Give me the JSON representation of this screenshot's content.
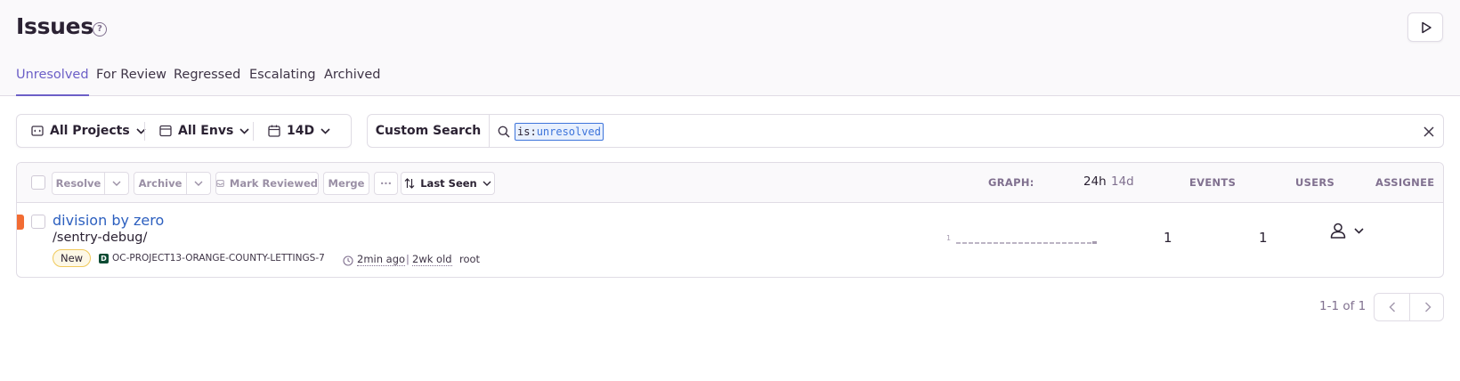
{
  "header": {
    "title": "Issues",
    "tabs": [
      {
        "label": "Unresolved",
        "active": true
      },
      {
        "label": "For Review",
        "active": false
      },
      {
        "label": "Regressed",
        "active": false
      },
      {
        "label": "Escalating",
        "active": false
      },
      {
        "label": "Archived",
        "active": false
      }
    ]
  },
  "filters": {
    "projects": "All Projects",
    "envs": "All Envs",
    "date": "14D"
  },
  "search": {
    "saved_search_label": "Custom Search",
    "token_key": "is:",
    "token_value": "unresolved"
  },
  "actions": {
    "resolve": "Resolve",
    "archive": "Archive",
    "mark_reviewed": "Mark Reviewed",
    "merge": "Merge",
    "more": "···",
    "sort": "Last Seen"
  },
  "columns": {
    "graph": "GRAPH:",
    "period_24h": "24h",
    "period_14d": "14d",
    "events": "EVENTS",
    "users": "USERS",
    "assignee": "ASSIGNEE"
  },
  "issue": {
    "title": "division by zero",
    "culprit": "/sentry-debug/",
    "badge": "New",
    "project_icon": "D",
    "short_id": "OC-PROJECT13-ORANGE-COUNTY-LETTINGS-7",
    "last_seen": "2min ago",
    "separator": "|",
    "first_seen": "2wk old",
    "logger": "root",
    "spark_max": "1",
    "events": "1",
    "users": "1"
  },
  "pagination": {
    "caption": "1-1 of 1"
  },
  "colors": {
    "accent": "#6c5fc7",
    "link": "#2c5fbf",
    "level_error": "#f26c33"
  }
}
